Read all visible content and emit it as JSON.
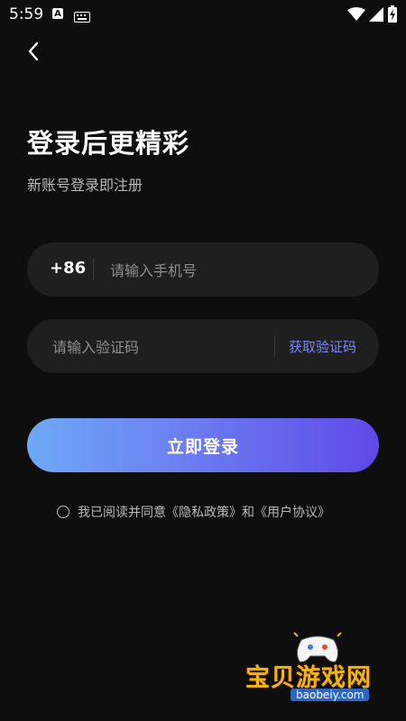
{
  "status_bar": {
    "time": "5:59",
    "icons": [
      "a-app-icon",
      "keyboard-icon",
      "wifi-icon",
      "signal-icon",
      "battery-charging-icon"
    ]
  },
  "nav": {
    "back_icon": "chevron-left-icon"
  },
  "header": {
    "title": "登录后更精彩",
    "subtitle": "新账号登录即注册"
  },
  "phone_field": {
    "country_code": "+86",
    "placeholder": "请输入手机号",
    "value": ""
  },
  "code_field": {
    "placeholder": "请输入验证码",
    "value": "",
    "get_code_label": "获取验证码"
  },
  "login_button": {
    "label": "立即登录"
  },
  "agreement": {
    "checked": false,
    "prefix": "我已阅读并同意",
    "privacy_link": "《隐私政策》",
    "and": "和",
    "terms_link": "《用户协议》"
  },
  "watermark": {
    "title": "宝贝游戏网",
    "url": "baobeiy.com"
  },
  "colors": {
    "background": "#0e0e0e",
    "input_bg": "#1f1f1f",
    "accent_link": "#7d86f2",
    "button_gradient_start": "#6ea9f7",
    "button_gradient_end": "#5f49e8"
  }
}
